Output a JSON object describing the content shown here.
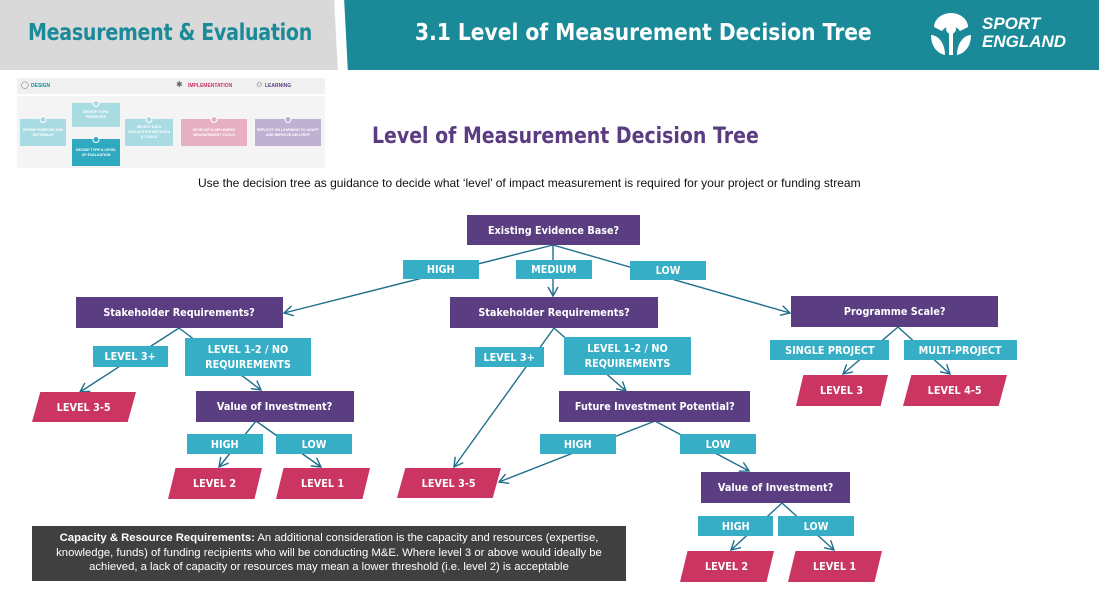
{
  "header": {
    "left_title": "Measurement & Evaluation",
    "right_title": "3.1 Level of Measurement Decision Tree",
    "logo_line1": "SPORT",
    "logo_line2": "ENGLAND"
  },
  "process_thumbnail": {
    "phases": [
      {
        "label": "DESIGN",
        "icon": "lightbulb-icon",
        "color": "#1a8998"
      },
      {
        "label": "IMPLEMENTATION",
        "icon": "runner-icon",
        "color": "#cb3561"
      },
      {
        "label": "LEARNING",
        "icon": "medal-icon",
        "color": "#5b3d82"
      }
    ],
    "steps": [
      {
        "num": "1",
        "label": "DEFINE PURPOSE AND RATIONALE"
      },
      {
        "num": "2",
        "label": "IDENTIFY KPIs/ PRIORITIES"
      },
      {
        "num": "3",
        "label": "DECIDE TYPE & LEVEL OF EVALUATION"
      },
      {
        "num": "4",
        "label": "SELECT DATA COLLECTION METHODS & TOOLS"
      },
      {
        "num": "5",
        "label": "DEVELOP & IMPLEMENT MEASUREMENT TOOLS"
      },
      {
        "num": "6",
        "label": "REFLECT ON LEARNING TO ADAPT AND IMPROVE DELIVERY"
      }
    ]
  },
  "page": {
    "title": "Level of Measurement Decision Tree",
    "intro": "Use the decision tree as guidance to decide what ‘level’ of impact measurement is required for your project or funding stream"
  },
  "tree": {
    "root": "Existing Evidence Base?",
    "root_options": {
      "high": "HIGH",
      "medium": "MEDIUM",
      "low": "LOW"
    },
    "left": {
      "question": "Stakeholder Requirements?",
      "opt_a": "LEVEL 3+",
      "opt_b": "LEVEL 1-2 / NO REQUIREMENTS",
      "result_a": "LEVEL 3-5",
      "sub_question": "Value of Investment?",
      "sub_opt_high": "HIGH",
      "sub_opt_low": "LOW",
      "sub_result_high": "LEVEL 2",
      "sub_result_low": "LEVEL 1"
    },
    "middle": {
      "question": "Stakeholder Requirements?",
      "opt_a": "LEVEL 3+",
      "opt_b": "LEVEL 1-2 / NO REQUIREMENTS",
      "sub_question": "Future Investment Potential?",
      "sub_opt_high": "HIGH",
      "sub_opt_low": "LOW",
      "result_shared": "LEVEL 3-5",
      "sub2_question": "Value of Investment?",
      "sub2_opt_high": "HIGH",
      "sub2_opt_low": "LOW",
      "sub2_result_high": "LEVEL 2",
      "sub2_result_low": "LEVEL 1"
    },
    "right": {
      "question": "Programme Scale?",
      "opt_a": "SINGLE PROJECT",
      "opt_b": "MULTI-PROJECT",
      "result_a": "LEVEL 3",
      "result_b": "LEVEL 4-5"
    }
  },
  "note": {
    "bold": "Capacity & Resource Requirements:",
    "text": " An additional consideration is the capacity and resources (expertise, knowledge, funds) of funding recipients who will be conducting M&E. Where level 3 or above would ideally be achieved, a lack of capacity or resources may mean a lower threshold (i.e. level 2) is acceptable"
  },
  "colors": {
    "teal": "#1a8998",
    "question": "#5b3d82",
    "option": "#36aec6",
    "result": "#cb3561",
    "connector": "#1f6e8c"
  }
}
